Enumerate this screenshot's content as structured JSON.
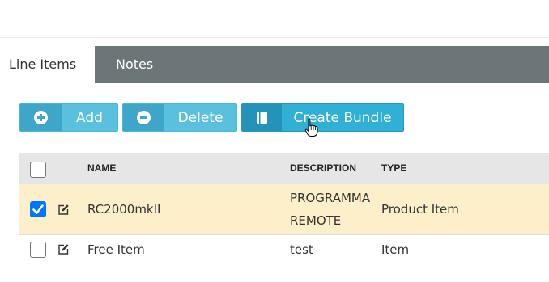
{
  "tabs": [
    {
      "label": "Line Items",
      "active": true
    },
    {
      "label": "Notes",
      "active": false
    }
  ],
  "toolbar": {
    "add_label": "Add",
    "delete_label": "Delete",
    "create_bundle_label": "Create Bundle"
  },
  "icons": {
    "add": "plus-circle-icon",
    "delete": "minus-circle-icon",
    "create_bundle": "book-icon",
    "cursor": "hand-pointer-icon",
    "edit": "edit-icon"
  },
  "table": {
    "columns": [
      "NAME",
      "DESCRIPTION",
      "TYPE"
    ],
    "rows": [
      {
        "checked": true,
        "name": "RC2000mkII",
        "description_line1": "PROGRAMMA",
        "description_line2": "REMOTE",
        "type": "Product Item"
      },
      {
        "checked": false,
        "name": "Free Item",
        "description_line1": "test",
        "description_line2": "",
        "type": "Item"
      }
    ]
  },
  "colors": {
    "tab_bar": "#6c7678",
    "button_light": "#5bc0de",
    "button_dark": "#31b0d5",
    "selected_row": "#fdefc9",
    "header_bg": "#e6e6e6",
    "checkbox_checked": "#0075ff"
  }
}
